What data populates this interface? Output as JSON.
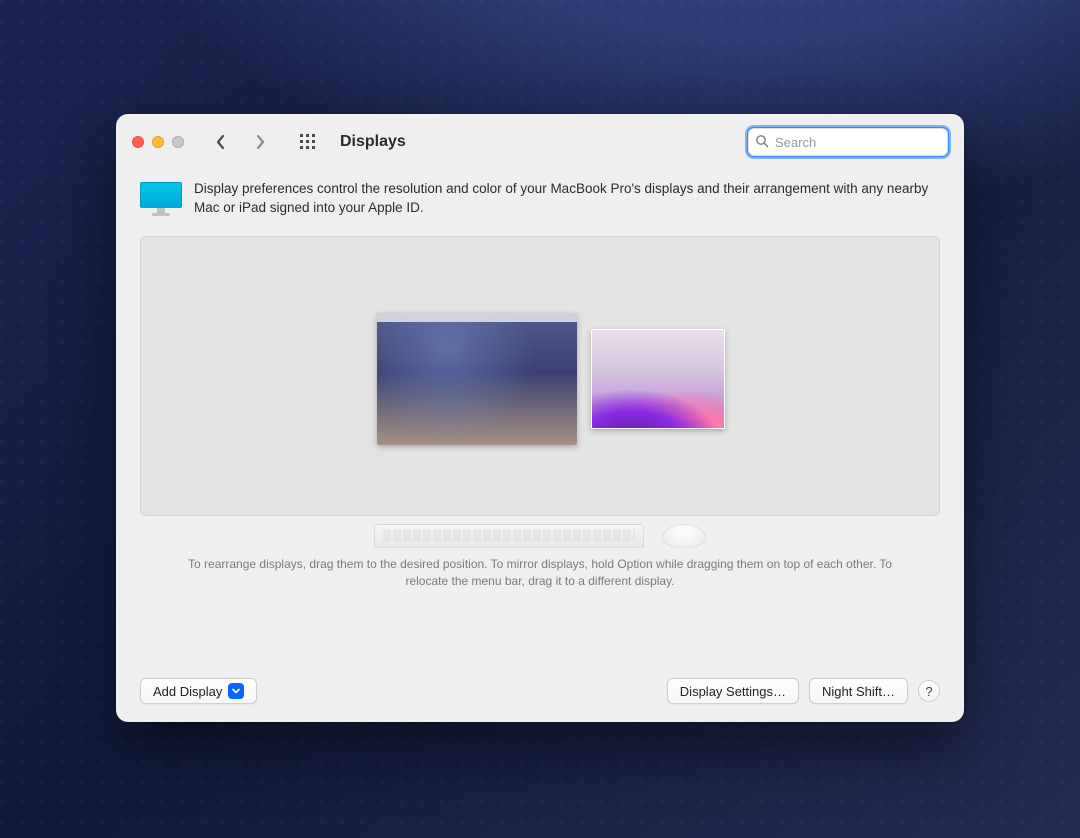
{
  "title": "Displays",
  "search": {
    "placeholder": "Search",
    "value": ""
  },
  "intro": "Display preferences control the resolution and color of your MacBook Pro's displays and their arrangement with any nearby Mac or iPad signed into your Apple ID.",
  "hint": "To rearrange displays, drag them to the desired position. To mirror displays, hold Option while dragging them on top of each other. To relocate the menu bar, drag it to a different display.",
  "buttons": {
    "add_display": "Add Display",
    "display_settings": "Display Settings…",
    "night_shift": "Night Shift…",
    "help": "?"
  }
}
